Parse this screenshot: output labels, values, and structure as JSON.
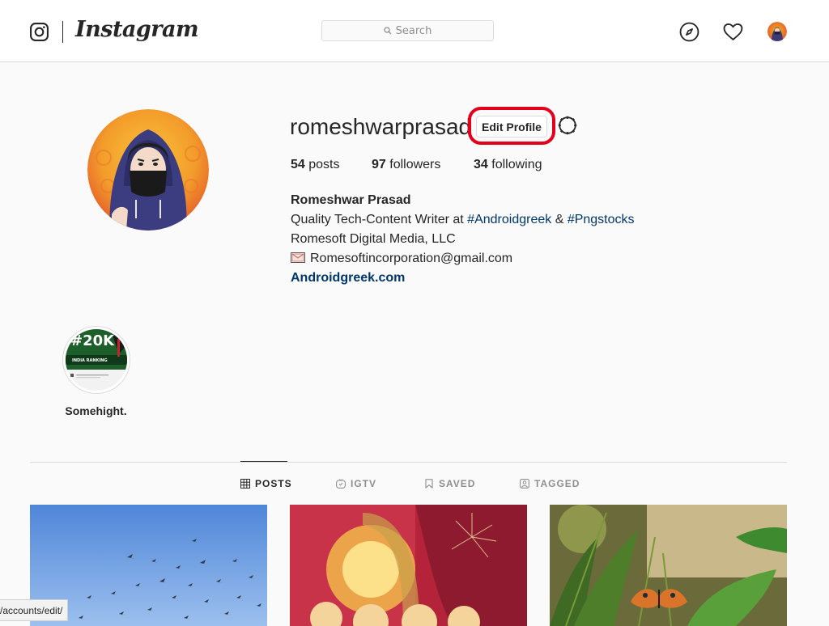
{
  "header": {
    "wordmark": "Instagram",
    "search_placeholder": "Search",
    "icons": [
      "instagram-logo-icon",
      "compass-icon",
      "heart-icon",
      "profile-avatar"
    ]
  },
  "profile": {
    "username": "romeshwarprasad",
    "edit_profile_label": "Edit Profile",
    "stats": [
      {
        "count": "54",
        "label": "posts"
      },
      {
        "count": "97",
        "label": "followers"
      },
      {
        "count": "34",
        "label": "following"
      }
    ],
    "full_name": "Romeshwar Prasad",
    "bio_line1_prefix": "Quality Tech-Content Writer at ",
    "bio_tag1": "#Androidgreek",
    "bio_amp": " & ",
    "bio_tag2": "#Pngstocks",
    "bio_line2": "Romesoft Digital Media, LLC",
    "bio_email": "Romesoftincorporation@gmail.com",
    "website": "Androidgreek.com"
  },
  "highlight": {
    "label": "Somehight.",
    "image_text": "#20K",
    "image_subtext": "INDIA RANKING"
  },
  "tabs": [
    {
      "label": "POSTS",
      "active": true
    },
    {
      "label": "IGTV",
      "active": false
    },
    {
      "label": "SAVED",
      "active": false
    },
    {
      "label": "TAGGED",
      "active": false
    }
  ],
  "status_url": "/accounts/edit/",
  "colors": {
    "accent_link": "#00376b",
    "highlight_ring": "#e3001b",
    "border": "#dbdbdb",
    "text": "#262626",
    "muted": "#8e8e8e"
  }
}
